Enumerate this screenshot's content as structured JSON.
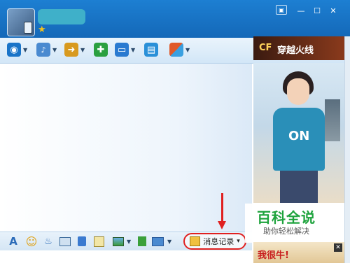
{
  "window": {
    "controls": {
      "skin_icon": "▣",
      "minimize": "—",
      "maximize": "☐",
      "close": "✕"
    }
  },
  "toolbar": {
    "items": [
      {
        "icon": "webcam-icon",
        "glyph": "◉",
        "color": "#1a74c8"
      },
      {
        "icon": "microphone-icon",
        "glyph": "🎤",
        "color": "#4a8ad0"
      },
      {
        "icon": "file-transfer-icon",
        "glyph": "➜",
        "color": "#d89a20"
      },
      {
        "icon": "add-contact-icon",
        "glyph": "✚",
        "color": "#2aa040"
      },
      {
        "icon": "screen-share-icon",
        "glyph": "▭",
        "color": "#2a7ad0"
      },
      {
        "icon": "remote-assist-icon",
        "glyph": "▤",
        "color": "#2a90d8"
      },
      {
        "icon": "apps-icon",
        "glyph": "▦",
        "color": "#e05a2a"
      }
    ]
  },
  "ads": {
    "top_text": "穿越火线",
    "top_logo": "CF",
    "main_print": "ON",
    "bottom_text": "我很牛!",
    "close_glyph": "✕"
  },
  "bottombar": {
    "font_icon": "A",
    "emoji_icon": "☺",
    "shake_icon": "♨",
    "message_history_label": "消息记录",
    "dropdown_glyph": "▾"
  },
  "watermark": {
    "title": "百科全说",
    "subtitle": "助你轻松解决"
  },
  "profile": {
    "star_glyph": "★"
  }
}
